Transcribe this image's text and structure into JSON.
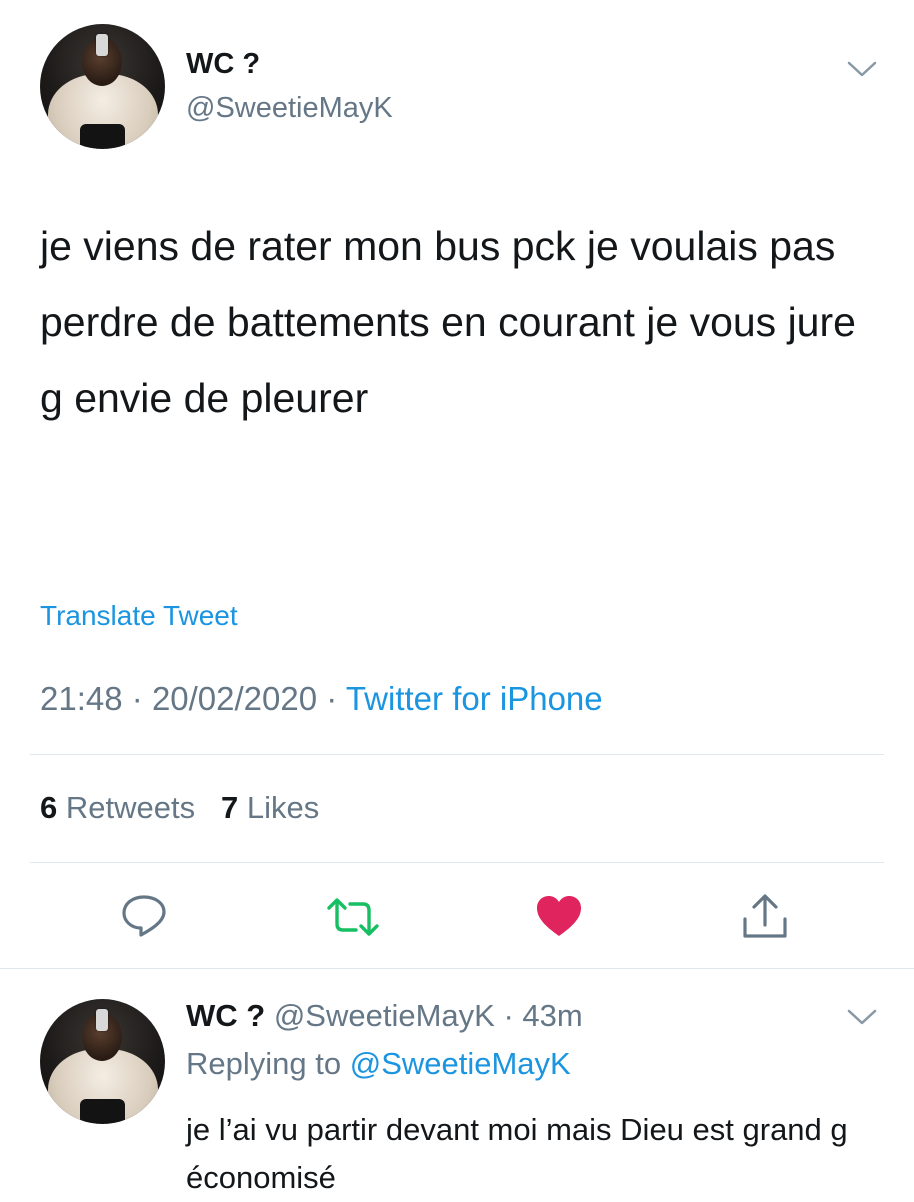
{
  "tweet": {
    "display_name": "WC ?",
    "handle": "@SweetieMayK",
    "text": "je viens de rater mon bus pck je voulais pas perdre de battements en courant je vous jure g envie de pleurer",
    "translate_label": "Translate Tweet",
    "time": "21:48",
    "date": "20/02/2020",
    "source": "Twitter for iPhone",
    "retweet_count": "6",
    "retweet_label": "Retweets",
    "like_count": "7",
    "like_label": "Likes",
    "liked": true
  },
  "reply": {
    "display_name": "WC ?",
    "handle": "@SweetieMayK",
    "age": "43m",
    "replying_prefix": "Replying to",
    "replying_to": "@SweetieMayK",
    "text": "je l’ai vu partir devant moi mais Dieu est grand g économisé"
  },
  "icons": {
    "reply": "reply-icon",
    "retweet": "retweet-icon",
    "like": "heart-icon",
    "share": "share-icon",
    "more": "chevron-down-icon"
  },
  "colors": {
    "link": "#1b95e0",
    "secondary_text": "#657786",
    "retweet_green": "#17bf63",
    "like_red": "#e0245e",
    "divider": "#e1e8ed"
  }
}
